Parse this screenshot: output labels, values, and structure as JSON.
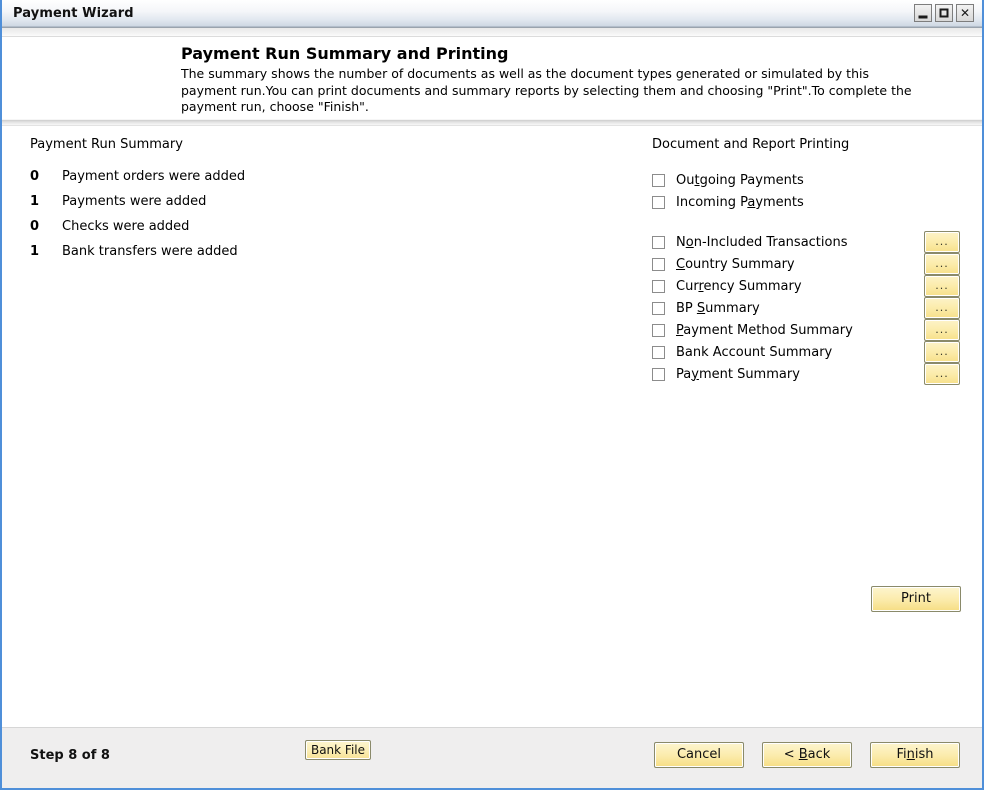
{
  "window": {
    "title": "Payment Wizard",
    "controls": [
      {
        "name": "minimize-button",
        "icon": "minimize-icon",
        "label": ""
      },
      {
        "name": "maximize-button",
        "icon": "maximize-icon",
        "label": ""
      },
      {
        "name": "close-button",
        "icon": "close-icon",
        "label": "✕"
      }
    ]
  },
  "header": {
    "title": "Payment Run Summary and Printing",
    "description": "The summary shows the number of documents as well as the document types generated or simulated by this payment run.You can print documents and summary reports by selecting them and choosing \"Print\".To complete the payment run, choose \"Finish\"."
  },
  "summary": {
    "heading": "Payment Run Summary",
    "rows": [
      {
        "count": "0",
        "text": "Payment orders were added"
      },
      {
        "count": "1",
        "text": "Payments were added"
      },
      {
        "count": "0",
        "text": "Checks were added"
      },
      {
        "count": "1",
        "text": "Bank transfers were added"
      }
    ]
  },
  "printing": {
    "heading": "Document and Report Printing",
    "ellipsis_label": "...",
    "options": [
      {
        "label": "Outgoing Payments",
        "accel_index": 2,
        "checked": false,
        "has_ellipsis": false,
        "gap_above": false
      },
      {
        "label": "Incoming Payments",
        "accel_index": 10,
        "checked": false,
        "has_ellipsis": false,
        "gap_above": false
      },
      {
        "label": "Non-Included Transactions",
        "accel_index": 1,
        "checked": false,
        "has_ellipsis": true,
        "gap_above": true
      },
      {
        "label": "Country Summary",
        "accel_index": 0,
        "checked": false,
        "has_ellipsis": true,
        "gap_above": false
      },
      {
        "label": "Currency Summary",
        "accel_index": 3,
        "checked": false,
        "has_ellipsis": true,
        "gap_above": false
      },
      {
        "label": "BP Summary",
        "accel_index": 3,
        "checked": false,
        "has_ellipsis": true,
        "gap_above": false
      },
      {
        "label": "Payment Method Summary",
        "accel_index": 0,
        "checked": false,
        "has_ellipsis": true,
        "gap_above": false
      },
      {
        "label": "Bank Account Summary",
        "accel_index": -1,
        "checked": false,
        "has_ellipsis": true,
        "gap_above": false
      },
      {
        "label": "Payment Summary",
        "accel_index": 2,
        "checked": false,
        "has_ellipsis": true,
        "gap_above": false
      }
    ],
    "print_button": "Print"
  },
  "footer": {
    "step_label": "Step 8 of 8",
    "bank_file_button": "Bank File",
    "nav_buttons": [
      {
        "name": "cancel-button",
        "label": "Cancel",
        "accel_index": -1
      },
      {
        "name": "back-button",
        "label": "< Back",
        "accel_index": 2
      },
      {
        "name": "finish-button",
        "label": "Finish",
        "accel_index": 2
      }
    ]
  },
  "colors": {
    "window_border": "#4f8fd9",
    "button_face": "#fbeba8",
    "button_border": "#8a8a6a",
    "footer_bg": "#efeeee",
    "content_bg": "#ffffff"
  }
}
